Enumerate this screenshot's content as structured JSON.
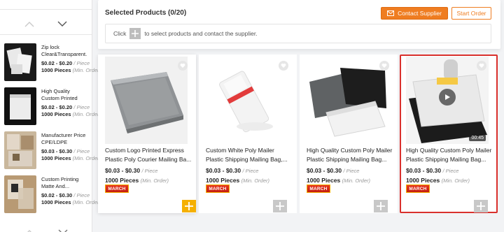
{
  "selected_products": {
    "title": "Selected Products (0/20)",
    "contact_button": "Contact Supplier",
    "start_order_button": "Start Order",
    "hint_before": "Click",
    "hint_after": "to select products and contact the supplier."
  },
  "sidebar": {
    "items": [
      {
        "title": "Zip lock Clear&Transparent...",
        "price": "$0.02 - $0.20",
        "unit": "/ Piece",
        "moq": "1000 Pieces",
        "moq_note": "(Min. Order)"
      },
      {
        "title": "High Quality Custom Printed Glossy Whit...",
        "price": "$0.02 - $0.20",
        "unit": "/ Piece",
        "moq": "1000 Pieces",
        "moq_note": "(Min. Order)"
      },
      {
        "title": "Manufacturer Price CPE/LDPE Plastic...",
        "price": "$0.03 - $0.30",
        "unit": "/ Piece",
        "moq": "1000 Pieces",
        "moq_note": "(Min. Order)"
      },
      {
        "title": "Custom Printing Matte And...",
        "price": "$0.02 - $0.30",
        "unit": "/ Piece",
        "moq": "1000 Pieces",
        "moq_note": "(Min. Order)"
      }
    ]
  },
  "products": [
    {
      "title": "Custom Logo Printed Express Plastic Poly Courier Mailing Ba...",
      "price": "$0.03 - $0.30",
      "unit": "/ Piece",
      "moq": "1000 Pieces",
      "moq_note": "(Min. Order)",
      "badge": "MARCH"
    },
    {
      "title": "Custom White Poly Mailer Plastic Shipping Mailing Bag,...",
      "price": "$0.03 - $0.30",
      "unit": "/ Piece",
      "moq": "1000 Pieces",
      "moq_note": "(Min. Order)",
      "badge": "MARCH"
    },
    {
      "title": "High Quality Custom Poly Mailer Plastic Shipping Mailing Bag...",
      "price": "$0.03 - $0.30",
      "unit": "/ Piece",
      "moq": "1000 Pieces",
      "moq_note": "(Min. Order)",
      "badge": "MARCH"
    },
    {
      "title": "High Quality Custom Poly Mailer Plastic Shipping Mailing Bag...",
      "price": "$0.03 - $0.30",
      "unit": "/ Piece",
      "moq": "1000 Pieces",
      "moq_note": "(Min. Order)",
      "badge": "MARCH",
      "video_duration": "00:45"
    }
  ],
  "colors": {
    "accent": "#ef7d21",
    "highlight_border": "#d9302c",
    "add_active": "#f5b000",
    "add_inactive": "#c8c8c8"
  }
}
